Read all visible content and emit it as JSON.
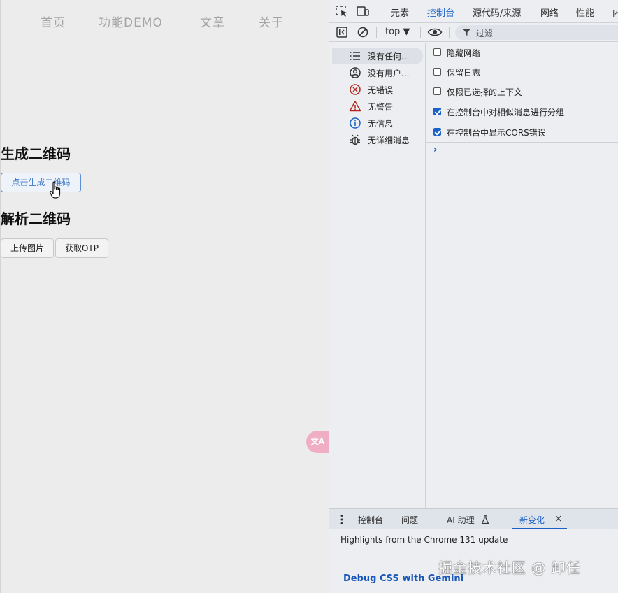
{
  "page": {
    "nav": [
      "首页",
      "功能DEMO",
      "文章",
      "关于"
    ],
    "generate_title": "生成二维码",
    "generate_button": "点击生成二维码",
    "parse_title": "解析二维码",
    "upload_button": "上传图片",
    "otp_button": "获取OTP",
    "translate_icon": "translate-icon"
  },
  "devtools": {
    "tabs": [
      "元素",
      "控制台",
      "源代码/来源",
      "网络",
      "性能",
      "内"
    ],
    "active_tab": "控制台",
    "toolbar": {
      "context": "top ▼",
      "filter_placeholder": "过滤"
    },
    "sidebar": [
      {
        "label": "没有任何...",
        "icon": "list-icon"
      },
      {
        "label": "没有用户...",
        "icon": "user-icon"
      },
      {
        "label": "无错误",
        "icon": "error-icon"
      },
      {
        "label": "无警告",
        "icon": "warning-icon"
      },
      {
        "label": "无信息",
        "icon": "info-icon"
      },
      {
        "label": "无详细消息",
        "icon": "bug-icon"
      }
    ],
    "settings": [
      {
        "label": "隐藏网络",
        "checked": false
      },
      {
        "label": "保留日志",
        "checked": false
      },
      {
        "label": "仅限已选择的上下文",
        "checked": false
      },
      {
        "label": "在控制台中对相似消息进行分组",
        "checked": true
      },
      {
        "label": "在控制台中显示CORS错误",
        "checked": true
      }
    ],
    "prompt": "›",
    "drawer": {
      "tabs": [
        "控制台",
        "问题",
        "AI 助理",
        "新变化"
      ],
      "active_tab": "新变化",
      "close": "×",
      "highlights": "Highlights from the Chrome 131 update",
      "debug_link": "Debug CSS with Gemini"
    },
    "colors": {
      "accent": "#1a62c7",
      "checkbox_checked": "#1a62c7"
    }
  },
  "watermark": "掘金技术社区 @ 卸任"
}
